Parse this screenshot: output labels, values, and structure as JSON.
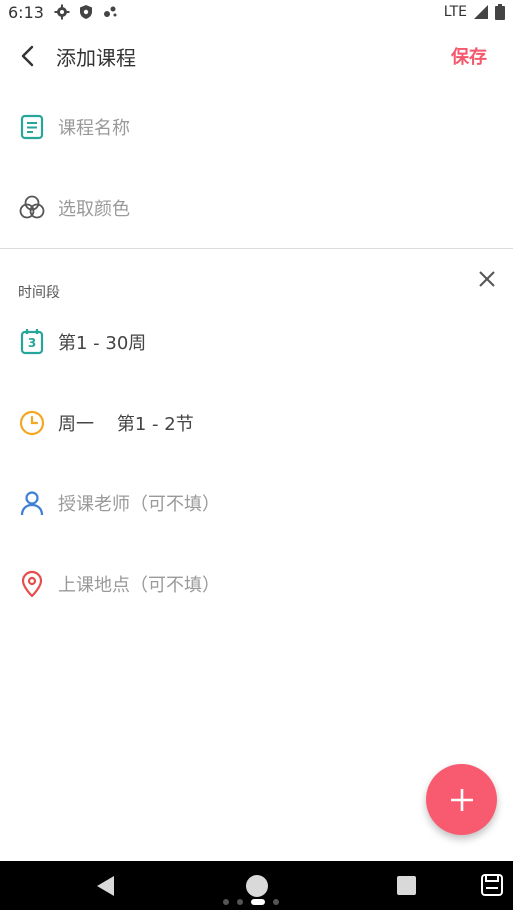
{
  "status_bar": {
    "time": "6:13",
    "network": "LTE",
    "icons": [
      "gear-icon",
      "shield-icon",
      "notification-icon",
      "signal-icon",
      "battery-icon"
    ]
  },
  "appbar": {
    "title": "添加课程",
    "save_label": "保存",
    "back_icon": "back-arrow-icon"
  },
  "course_fields": {
    "name_placeholder": "课程名称",
    "color_label": "选取颜色"
  },
  "time_slot": {
    "header": "时间段",
    "weeks": "第1 - 30周",
    "calendar_day": "3",
    "day_period": "周一    第1 - 2节",
    "teacher_placeholder": "授课老师（可不填）",
    "location_placeholder": "上课地点（可不填）"
  },
  "colors": {
    "accent": "#f5576c",
    "teal": "#26a69a",
    "orange": "#f5a623",
    "blue": "#3d7fd6",
    "red": "#e84c4c"
  }
}
